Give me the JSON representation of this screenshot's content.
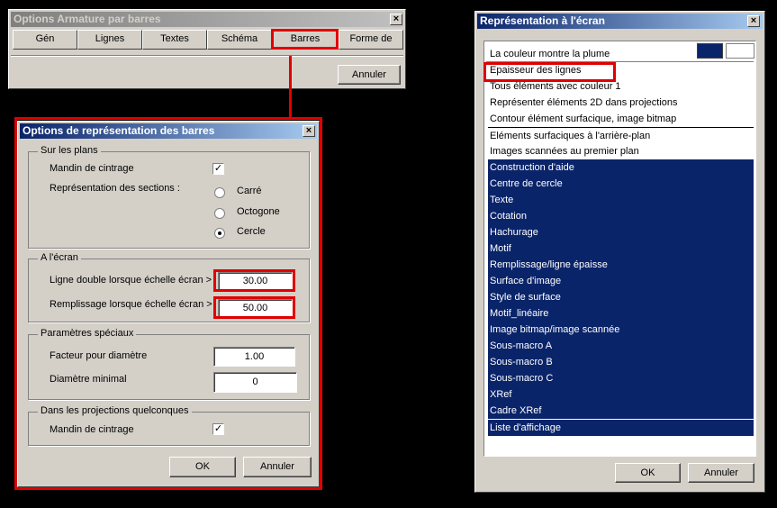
{
  "armature_window": {
    "title": "Options Armature par barres",
    "tabs": [
      "Gén",
      "Lignes",
      "Textes",
      "Schéma",
      "Barres",
      "Forme de"
    ],
    "cancel_label": "Annuler"
  },
  "bars_dialog": {
    "title": "Options de représentation des barres",
    "group_plans": {
      "legend": "Sur les plans",
      "bending_mandrel_label": "Mandin de cintrage",
      "bending_mandrel_checked": "✓",
      "sections_label": "Représentation des sections :",
      "options": [
        "Carré",
        "Octogone",
        "Cercle"
      ],
      "selected": "Cercle"
    },
    "group_screen": {
      "legend": "A l'écran",
      "double_line_label": "Ligne double lorsque échelle écran >",
      "double_line_value": "30.00",
      "fill_label": "Remplissage lorsque échelle écran >",
      "fill_value": "50.00"
    },
    "group_special": {
      "legend": "Paramètres spéciaux",
      "diameter_factor_label": "Facteur pour diamètre",
      "diameter_factor_value": "1.00",
      "min_diameter_label": "Diamètre minimal",
      "min_diameter_value": "0"
    },
    "group_projections": {
      "legend": "Dans les projections quelconques",
      "bending_mandrel_label": "Mandin de cintrage",
      "bending_mandrel_checked": "✓"
    },
    "ok_label": "OK",
    "cancel_label": "Annuler"
  },
  "screen_window": {
    "title": "Représentation à l'écran",
    "color_swatches": [
      "#0a246a",
      "#ffffff"
    ],
    "items": [
      {
        "label": "La couleur montre la plume",
        "selected": false
      },
      {
        "label": "Epaisseur des lignes",
        "selected": false
      },
      {
        "label": "Tous éléments avec couleur 1",
        "selected": false
      },
      {
        "label": "Représenter éléments 2D dans projections",
        "selected": false
      },
      {
        "label": "Contour élément surfacique, image bitmap",
        "selected": false
      },
      {
        "label": "Eléments surfaciques à l'arrière-plan",
        "selected": false
      },
      {
        "label": "Images scannées au premier plan",
        "selected": false
      },
      {
        "label": "Construction d'aide",
        "selected": true
      },
      {
        "label": "Centre de cercle",
        "selected": true
      },
      {
        "label": "Texte",
        "selected": true
      },
      {
        "label": "Cotation",
        "selected": true
      },
      {
        "label": "Hachurage",
        "selected": true
      },
      {
        "label": "Motif",
        "selected": true
      },
      {
        "label": "Remplissage/ligne épaisse",
        "selected": true
      },
      {
        "label": "Surface d'image",
        "selected": true
      },
      {
        "label": "Style de surface",
        "selected": true
      },
      {
        "label": "Motif_linéaire",
        "selected": true
      },
      {
        "label": "Image bitmap/image scannée",
        "selected": true
      },
      {
        "label": "Sous-macro A",
        "selected": true
      },
      {
        "label": "Sous-macro B",
        "selected": true
      },
      {
        "label": "Sous-macro C",
        "selected": true
      },
      {
        "label": "XRef",
        "selected": true
      },
      {
        "label": "Cadre XRef",
        "selected": true
      },
      {
        "label": "Liste d'affichage",
        "selected": true
      }
    ],
    "ok_label": "OK",
    "cancel_label": "Annuler"
  },
  "colors": {
    "highlight": "#e00000",
    "selection": "#0a246a"
  }
}
